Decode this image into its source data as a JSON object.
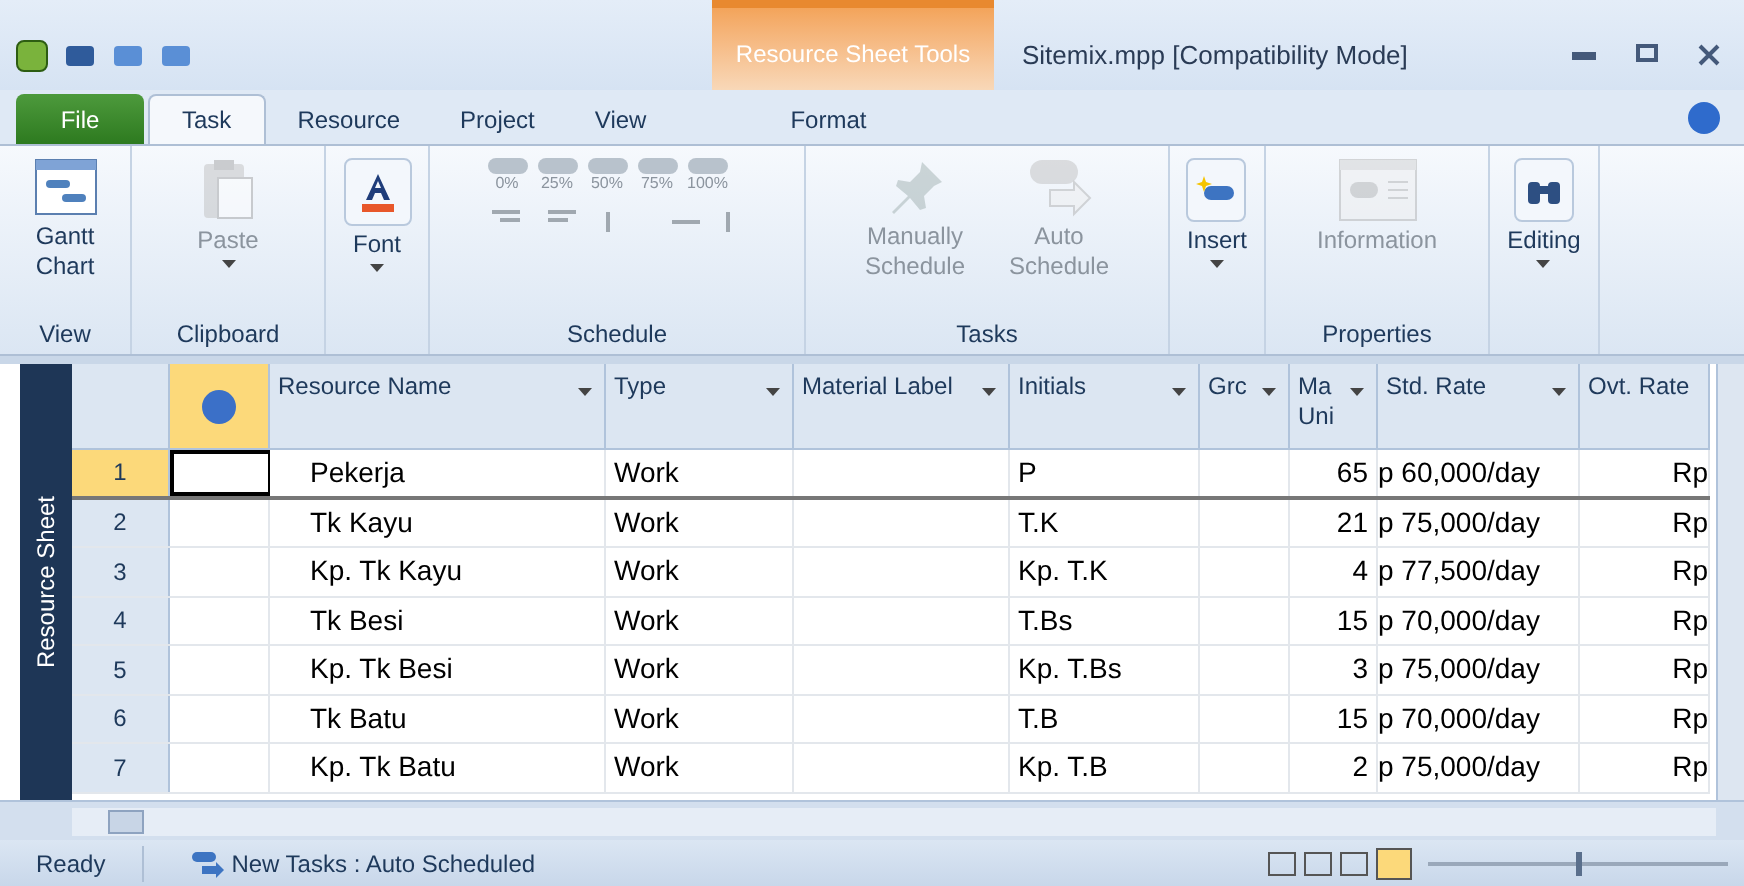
{
  "window": {
    "title": "Sitemix.mpp [Compatibility Mode]",
    "contextual_tab_group": "Resource Sheet Tools"
  },
  "tabs": [
    {
      "label": "File",
      "kind": "file",
      "selected": false
    },
    {
      "label": "Task",
      "kind": "tab",
      "selected": true
    },
    {
      "label": "Resource",
      "kind": "tab",
      "selected": false
    },
    {
      "label": "Project",
      "kind": "tab",
      "selected": false
    },
    {
      "label": "View",
      "kind": "tab",
      "selected": false
    },
    {
      "label": "Format",
      "kind": "tab",
      "selected": false
    }
  ],
  "ribbon_groups": [
    {
      "label": "View",
      "buttons": [
        {
          "label": "Gantt Chart",
          "disabled": false
        }
      ]
    },
    {
      "label": "Clipboard",
      "buttons": [
        {
          "label": "Paste",
          "disabled": true
        }
      ]
    },
    {
      "buttons": [
        {
          "label": "Font",
          "disabled": false
        }
      ]
    },
    {
      "label": "Schedule",
      "percent_labels": [
        "0%",
        "25%",
        "50%",
        "75%",
        "100%"
      ]
    },
    {
      "label": "Tasks",
      "buttons": [
        {
          "label": "Manually Schedule",
          "disabled": true
        },
        {
          "label": "Auto Schedule",
          "disabled": true
        }
      ]
    },
    {
      "buttons": [
        {
          "label": "Insert",
          "disabled": false
        }
      ]
    },
    {
      "label": "Properties",
      "buttons": [
        {
          "label": "Information",
          "disabled": true
        }
      ]
    },
    {
      "buttons": [
        {
          "label": "Editing",
          "disabled": false
        }
      ]
    }
  ],
  "side_label": "Resource Sheet",
  "table": {
    "columns": [
      "Resource Name",
      "Type",
      "Material Label",
      "Initials",
      "Grc",
      "Ma Uni",
      "Std. Rate",
      "Ovt. Rate"
    ],
    "rows": [
      {
        "number": "1",
        "selected": true,
        "cells": [
          "Pekerja",
          "Work",
          "",
          "P",
          "",
          "65",
          "p 60,000/day",
          "Rp"
        ]
      },
      {
        "number": "2",
        "selected": false,
        "cells": [
          "Tk Kayu",
          "Work",
          "",
          "T.K",
          "",
          "21",
          "p 75,000/day",
          "Rp"
        ]
      },
      {
        "number": "3",
        "selected": false,
        "cells": [
          "Kp. Tk Kayu",
          "Work",
          "",
          "Kp. T.K",
          "",
          "4",
          "p 77,500/day",
          "Rp"
        ]
      },
      {
        "number": "4",
        "selected": false,
        "cells": [
          "Tk Besi",
          "Work",
          "",
          "T.Bs",
          "",
          "15",
          "p 70,000/day",
          "Rp"
        ]
      },
      {
        "number": "5",
        "selected": false,
        "cells": [
          "Kp. Tk Besi",
          "Work",
          "",
          "Kp. T.Bs",
          "",
          "3",
          "p 75,000/day",
          "Rp"
        ]
      },
      {
        "number": "6",
        "selected": false,
        "cells": [
          "Tk Batu",
          "Work",
          "",
          "T.B",
          "",
          "15",
          "p 70,000/day",
          "Rp"
        ]
      },
      {
        "number": "7",
        "selected": false,
        "cells": [
          "Kp. Tk Batu",
          "Work",
          "",
          "Kp. T.B",
          "",
          "2",
          "p 75,000/day",
          "Rp"
        ]
      }
    ]
  },
  "status_bar": {
    "state": "Ready",
    "new_tasks": "New Tasks : Auto Scheduled",
    "zoom": {
      "level": 0.5
    }
  }
}
